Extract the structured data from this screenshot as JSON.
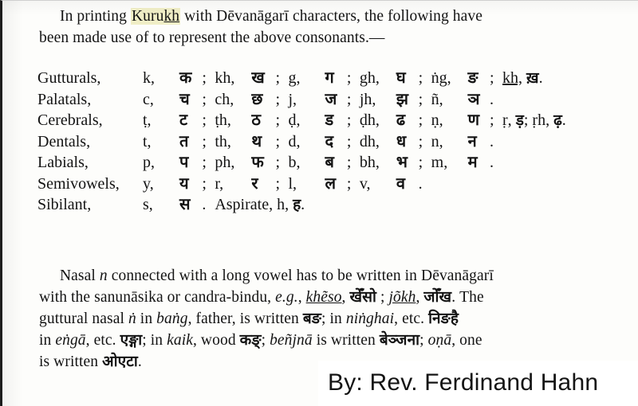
{
  "document": {
    "intro": {
      "line1_a": "In  printing  ",
      "highlight": "Kuru",
      "highlight_underlined": "kh",
      "line1_b": "  with  Dēvanāgarī  characters,  the  following  have",
      "line2": "been made use of  to represent the above consonants.—"
    },
    "table": {
      "rows": [
        {
          "class_label": "Gutturals,",
          "pairs": [
            {
              "roman": "k,",
              "devanagari": "क",
              "sep": ";"
            },
            {
              "roman": "kh,",
              "devanagari": "ख",
              "sep": ";"
            },
            {
              "roman": "g,",
              "devanagari": "ग",
              "sep": ";"
            },
            {
              "roman": "gh,",
              "devanagari": "घ",
              "sep": ";"
            },
            {
              "roman": "ṅg,",
              "devanagari": "ङ",
              "sep": ";"
            }
          ],
          "tail_roman": "kh,",
          "tail_roman_underlined": true,
          "tail_devanagari": "ख़",
          "tail_end": "."
        },
        {
          "class_label": "Palatals,",
          "pairs": [
            {
              "roman": "c,",
              "devanagari": "च",
              "sep": ";"
            },
            {
              "roman": "ch,",
              "devanagari": "छ",
              "sep": ";"
            },
            {
              "roman": "j,",
              "devanagari": "ज",
              "sep": ";"
            },
            {
              "roman": "jh,",
              "devanagari": "झ",
              "sep": ";"
            },
            {
              "roman": "ñ,",
              "devanagari": "ञ",
              "sep": "."
            }
          ],
          "tail_roman": "",
          "tail_devanagari": "",
          "tail_end": ""
        },
        {
          "class_label": "Cerebrals,",
          "pairs": [
            {
              "roman": "ṭ,",
              "devanagari": "ट",
              "sep": ";"
            },
            {
              "roman": "ṭh,",
              "devanagari": "ठ",
              "sep": ";"
            },
            {
              "roman": "ḍ,",
              "devanagari": "ड",
              "sep": ";"
            },
            {
              "roman": "ḍh,",
              "devanagari": "ढ",
              "sep": ";"
            },
            {
              "roman": "ṇ,",
              "devanagari": "ण",
              "sep": ";"
            }
          ],
          "tail_roman": "ṛ,",
          "tail_roman_underlined": false,
          "tail_devanagari": "ड़",
          "tail_mid": "; ṛh,",
          "tail_devanagari2": "ढ़",
          "tail_end": "."
        },
        {
          "class_label": "Dentals,",
          "pairs": [
            {
              "roman": "t,",
              "devanagari": "त",
              "sep": ";"
            },
            {
              "roman": "th,",
              "devanagari": "थ",
              "sep": ";"
            },
            {
              "roman": "d,",
              "devanagari": "द",
              "sep": ";"
            },
            {
              "roman": "dh,",
              "devanagari": "ध",
              "sep": ";"
            },
            {
              "roman": "n,",
              "devanagari": "न",
              "sep": "."
            }
          ],
          "tail_roman": "",
          "tail_devanagari": "",
          "tail_end": ""
        },
        {
          "class_label": "Labials,",
          "pairs": [
            {
              "roman": "p,",
              "devanagari": "प",
              "sep": ";"
            },
            {
              "roman": "ph,",
              "devanagari": "फ",
              "sep": ";"
            },
            {
              "roman": "b,",
              "devanagari": "ब",
              "sep": ";"
            },
            {
              "roman": "bh,",
              "devanagari": "भ",
              "sep": ";"
            },
            {
              "roman": "m,",
              "devanagari": "म",
              "sep": "."
            }
          ],
          "tail_roman": "",
          "tail_devanagari": "",
          "tail_end": ""
        },
        {
          "class_label": "Semivowels,",
          "pairs": [
            {
              "roman": "y,",
              "devanagari": "य",
              "sep": ";"
            },
            {
              "roman": "r,",
              "devanagari": "र",
              "sep": ";"
            },
            {
              "roman": "l,",
              "devanagari": "ल",
              "sep": ";"
            },
            {
              "roman": "v,",
              "devanagari": "व",
              "sep": "."
            }
          ],
          "tail_roman": "",
          "tail_devanagari": "",
          "tail_end": ""
        }
      ],
      "sibilant": {
        "class_label": "Sibilant,",
        "roman": "s,",
        "devanagari": "स",
        "end": ".",
        "aspirate_label": "Aspirate,",
        "aspirate_roman": "h,",
        "aspirate_devanagari": "ह",
        "aspirate_end": "."
      }
    },
    "nasal_paragraph": {
      "line1_a": "Nasal ",
      "line1_italic": "n",
      "line1_b": " connected with a long vowel has to be written in  Dēvanāgarī",
      "line2_a": "with the sanunāsika or candra-bindu,  ",
      "line2_eg": "e.g.",
      "line2_b": ", ",
      "line2_word1": "khẽso",
      "line2_dev1": "खेँसो",
      "line2_c": " ; ",
      "line2_word2": "jõkh",
      "line2_dev2": "जोँख",
      "line2_d": ".   The",
      "line3_a": "guttural nasal ",
      "line3_italic1": "ṅ",
      "line3_b": " in ",
      "line3_italic2": "baṅg",
      "line3_c": ", father, is written ",
      "line3_dev1": "बङ",
      "line3_d": "; in  ",
      "line3_italic3": "niṅghai",
      "line3_e": ", etc.  ",
      "line3_dev2": "निङहै",
      "line4_a": "in ",
      "line4_italic1": "eṅgā",
      "line4_b": ", etc. ",
      "line4_dev1": "एङ्गा",
      "line4_c": "; in ",
      "line4_italic2": "kaik",
      "line4_d": ", wood ",
      "line4_dev2": "कङ्",
      "line4_e": "; ",
      "line4_italic3": "beñjnā",
      "line4_f": " is written ",
      "line4_dev3": "बेञ्जना",
      "line4_g": "; ",
      "line4_italic4": "oṇā",
      "line4_h": ", one",
      "line5_a": "is written ",
      "line5_dev": "ओएटा",
      "line5_b": "."
    },
    "caption": {
      "text": "By: Rev. Ferdinand Hahn"
    },
    "colors": {
      "highlight": "#f0eec6",
      "ink": "#131313",
      "page": "#fdfdfb"
    }
  }
}
